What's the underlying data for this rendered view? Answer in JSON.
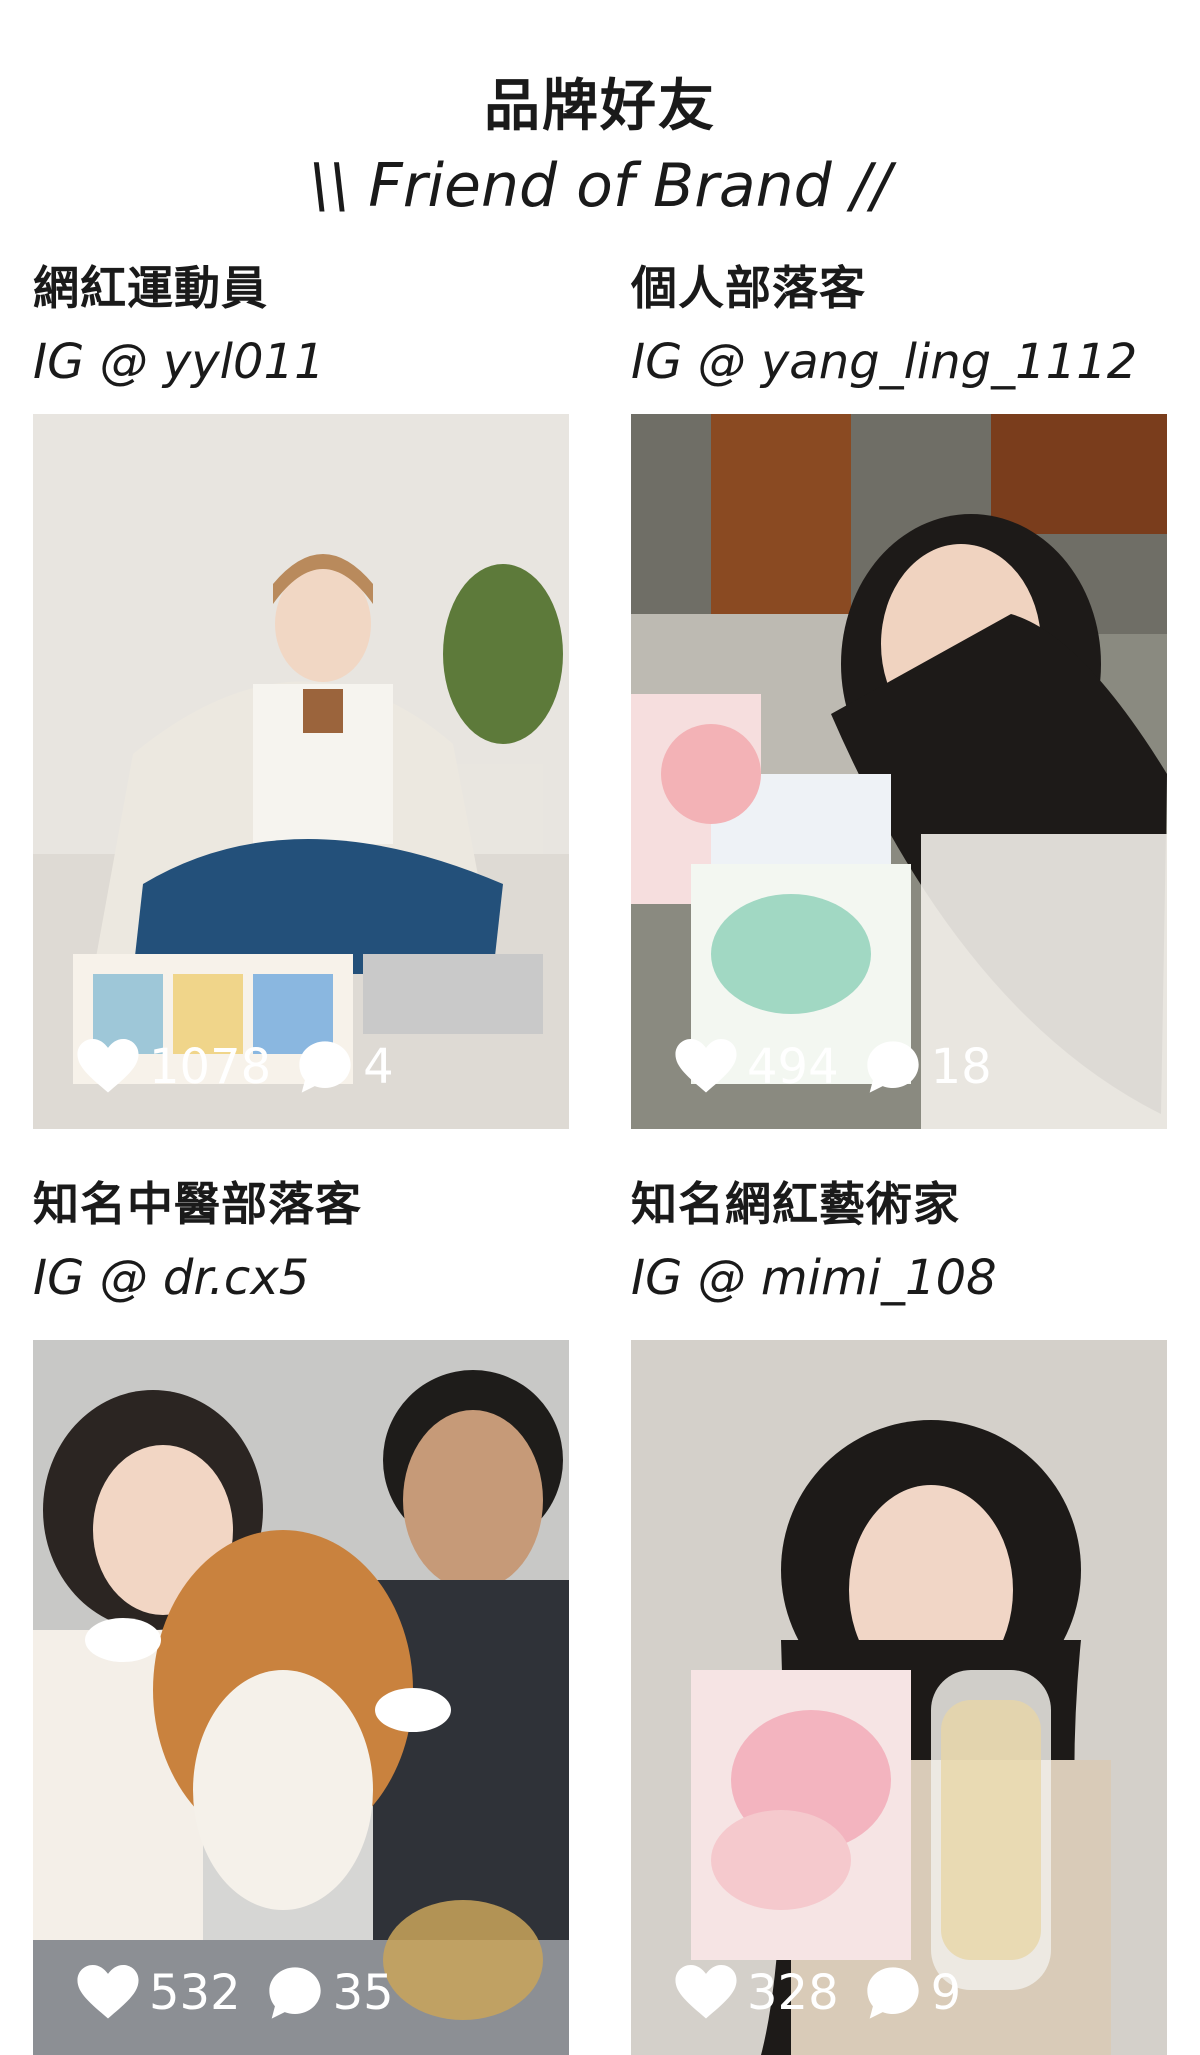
{
  "header": {
    "title_zh": "品牌好友",
    "title_en": "\\\\ Friend of Brand //"
  },
  "cards": [
    {
      "role": "網紅運動員",
      "handle": "IG @ yyl011",
      "likes": "1078",
      "comments": "4"
    },
    {
      "role": "個人部落客",
      "handle": "IG @ yang_ling_1112",
      "likes": "494",
      "comments": "18"
    },
    {
      "role": "知名中醫部落客",
      "handle": "IG @ dr.cx5",
      "likes": "532",
      "comments": "35"
    },
    {
      "role": "知名網紅藝術家",
      "handle": "IG @ mimi_108",
      "likes": "328",
      "comments": "9"
    }
  ],
  "icons": {
    "like": "heart-icon",
    "comment": "comment-bubble-icon"
  },
  "colors": {
    "text": "#1a1a1a",
    "background": "#ffffff",
    "overlay_text": "#ffffff"
  }
}
